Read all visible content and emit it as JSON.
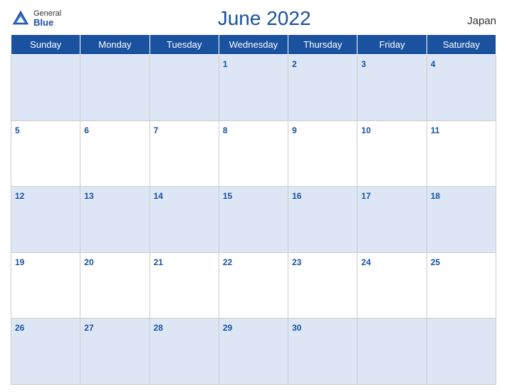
{
  "header": {
    "logo_general": "General",
    "logo_blue": "Blue",
    "title": "June 2022",
    "country": "Japan"
  },
  "days_of_week": [
    "Sunday",
    "Monday",
    "Tuesday",
    "Wednesday",
    "Thursday",
    "Friday",
    "Saturday"
  ],
  "weeks": [
    [
      {
        "day": "",
        "empty": true
      },
      {
        "day": "",
        "empty": true
      },
      {
        "day": "",
        "empty": true
      },
      {
        "day": "1",
        "empty": false
      },
      {
        "day": "2",
        "empty": false
      },
      {
        "day": "3",
        "empty": false
      },
      {
        "day": "4",
        "empty": false
      }
    ],
    [
      {
        "day": "5",
        "empty": false
      },
      {
        "day": "6",
        "empty": false
      },
      {
        "day": "7",
        "empty": false
      },
      {
        "day": "8",
        "empty": false
      },
      {
        "day": "9",
        "empty": false
      },
      {
        "day": "10",
        "empty": false
      },
      {
        "day": "11",
        "empty": false
      }
    ],
    [
      {
        "day": "12",
        "empty": false
      },
      {
        "day": "13",
        "empty": false
      },
      {
        "day": "14",
        "empty": false
      },
      {
        "day": "15",
        "empty": false
      },
      {
        "day": "16",
        "empty": false
      },
      {
        "day": "17",
        "empty": false
      },
      {
        "day": "18",
        "empty": false
      }
    ],
    [
      {
        "day": "19",
        "empty": false
      },
      {
        "day": "20",
        "empty": false
      },
      {
        "day": "21",
        "empty": false
      },
      {
        "day": "22",
        "empty": false
      },
      {
        "day": "23",
        "empty": false
      },
      {
        "day": "24",
        "empty": false
      },
      {
        "day": "25",
        "empty": false
      }
    ],
    [
      {
        "day": "26",
        "empty": false
      },
      {
        "day": "27",
        "empty": false
      },
      {
        "day": "28",
        "empty": false
      },
      {
        "day": "29",
        "empty": false
      },
      {
        "day": "30",
        "empty": false
      },
      {
        "day": "",
        "empty": true
      },
      {
        "day": "",
        "empty": true
      }
    ]
  ]
}
